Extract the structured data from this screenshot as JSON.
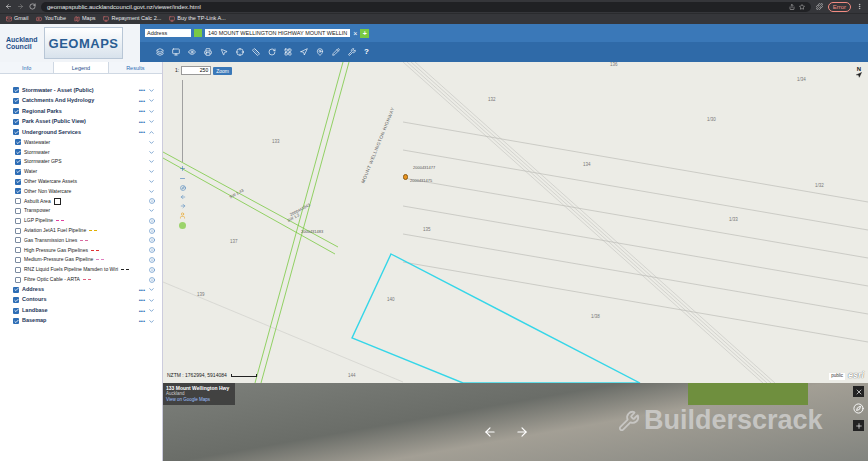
{
  "browser": {
    "url": "geomapspublic.aucklandcouncil.govt.nz/viewer/index.html",
    "profile": "Error",
    "bookmarks": [
      "Gmail",
      "YouTube",
      "Maps",
      "Repayment Calc 2...",
      "Buy the TP-Link A..."
    ]
  },
  "app": {
    "logo": [
      "Auckland",
      "Council"
    ],
    "title": "GEOMAPS",
    "search_type": "Address",
    "search_value": "140 MOUNT WELLINGTON HIGHWAY MOUNT WELLIN",
    "clear": "×",
    "add": "+",
    "help": "?"
  },
  "tabs": [
    {
      "label": "Info",
      "selected": false
    },
    {
      "label": "Legend",
      "selected": true
    },
    {
      "label": "Results",
      "selected": false
    }
  ],
  "legend_more": "•••",
  "legend": [
    {
      "label": "Stormwater - Asset (Public)",
      "checked": true,
      "expanded": false,
      "children": []
    },
    {
      "label": "Catchments And Hydrology",
      "checked": true,
      "expanded": false,
      "children": []
    },
    {
      "label": "Regional Parks",
      "checked": true,
      "expanded": false,
      "children": []
    },
    {
      "label": "Park Asset (Public View)",
      "checked": true,
      "expanded": false,
      "children": []
    },
    {
      "label": "Underground Services",
      "checked": true,
      "expanded": true,
      "children": [
        {
          "label": "Wastewater",
          "checked": true,
          "kind": "folder",
          "swatch": "none",
          "color": "#000000"
        },
        {
          "label": "Stormwater",
          "checked": true,
          "kind": "folder",
          "swatch": "none",
          "color": "#000000"
        },
        {
          "label": "Stormwater GPS",
          "checked": true,
          "kind": "folder",
          "swatch": "none",
          "color": "#000000"
        },
        {
          "label": "Water",
          "checked": true,
          "kind": "folder",
          "swatch": "none",
          "color": "#000000"
        },
        {
          "label": "Other Watercare Assets",
          "checked": true,
          "kind": "folder",
          "swatch": "none",
          "color": "#000000"
        },
        {
          "label": "Other Non Watercare",
          "checked": true,
          "kind": "folder",
          "swatch": "none",
          "color": "#000000"
        },
        {
          "label": "Asbuilt Area",
          "checked": false,
          "kind": "layer",
          "swatch": "box",
          "color": "#222222"
        },
        {
          "label": "Transpower",
          "checked": false,
          "kind": "folder",
          "swatch": "none",
          "color": "#000000"
        },
        {
          "label": "LGP Pipeline",
          "checked": false,
          "kind": "layer",
          "swatch": "line",
          "color": "#e040a0"
        },
        {
          "label": "Aviation JetA1 Fuel Pipeline",
          "checked": false,
          "kind": "layer",
          "swatch": "line",
          "color": "#e0b000"
        },
        {
          "label": "Gas Transmission Lines",
          "checked": false,
          "kind": "layer",
          "swatch": "line",
          "color": "#d96aa0"
        },
        {
          "label": "High Pressure Gas Pipelines",
          "checked": false,
          "kind": "layer",
          "swatch": "line",
          "color": "#e03030"
        },
        {
          "label": "Medium-Pressure Gas Pipeline",
          "checked": false,
          "kind": "layer",
          "swatch": "line",
          "color": "#e080c0"
        },
        {
          "label": "RNZ Liquid Fuels Pipeline Marsden to Wiri",
          "checked": false,
          "kind": "layer",
          "swatch": "line",
          "color": "#222222"
        },
        {
          "label": "Fibre Optic Cable - ARTA",
          "checked": false,
          "kind": "layer",
          "swatch": "line",
          "color": "#e06080"
        }
      ]
    },
    {
      "label": "Address",
      "checked": true,
      "expanded": false,
      "children": []
    },
    {
      "label": "Contours",
      "checked": true,
      "expanded": false,
      "children": []
    },
    {
      "label": "Landbase",
      "checked": true,
      "expanded": false,
      "children": []
    },
    {
      "label": "Basemap",
      "checked": true,
      "expanded": false,
      "children": []
    }
  ],
  "map": {
    "scale_prefix": "1:",
    "scale": "250",
    "zoom_button": "Zoom",
    "north": "N",
    "coordinates": "NZTM : 1762994, 5914084",
    "credits": [
      "public",
      "esri"
    ],
    "road": "MOUNT WELLINGTON HIGHWAY",
    "parcels": [
      "136",
      "1/34",
      "132",
      "1/30",
      "133",
      "134",
      "1/32",
      "1/33",
      "135",
      "137",
      "139",
      "140",
      "1/38",
      "144"
    ],
    "assets": [
      "2000431477",
      "2000431475",
      "2000441843",
      "SW 1.43",
      "SW 1.2",
      "2000431483"
    ]
  },
  "street_view": {
    "address": "133 Mount Wellington Hwy",
    "city": "Auckland",
    "link": "View on Google Maps"
  },
  "watermark": "Builderscrack"
}
